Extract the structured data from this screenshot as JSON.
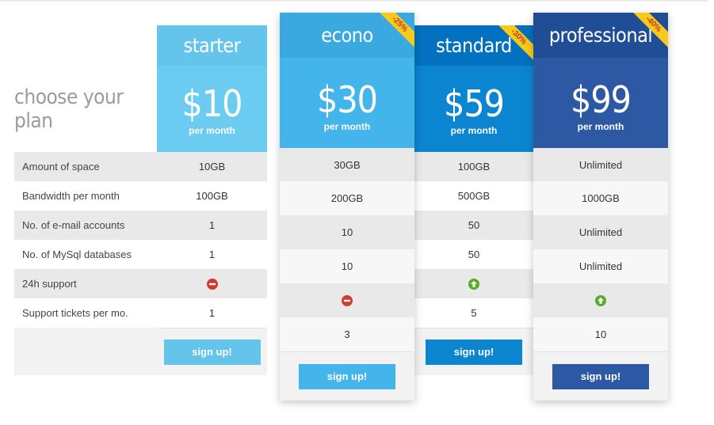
{
  "heading": "choose your plan",
  "features": [
    "Amount of space",
    "Bandwidth per month",
    "No. of e-mail accounts",
    "No. of MySql databases",
    "24h support",
    "Support tickets per mo."
  ],
  "colors": {
    "starter": "#64c4ec",
    "starter_price": "#6ccbf0",
    "econo": "#3aa9e0",
    "econo_price": "#43b5ea",
    "standard": "#0271bf",
    "standard_price": "#0c85d0",
    "professional": "#1f4e96",
    "professional_price": "#2d58a3",
    "no_icon": "#d23b34",
    "yes_icon": "#59a92b",
    "ribbon": "#f7c91a"
  },
  "plans": [
    {
      "id": "starter",
      "name": "starter",
      "price": "$10",
      "period": "per month",
      "badge": "",
      "values": [
        "10GB",
        "100GB",
        "1",
        "1",
        "no-icon",
        "1"
      ],
      "button": "sign up!"
    },
    {
      "id": "econo",
      "name": "econo",
      "price": "$30",
      "period": "per month",
      "badge": "-25%",
      "values": [
        "30GB",
        "200GB",
        "10",
        "10",
        "no-icon",
        "3"
      ],
      "button": "sign up!"
    },
    {
      "id": "standard",
      "name": "standard",
      "price": "$59",
      "period": "per month",
      "badge": "-30%",
      "values": [
        "100GB",
        "500GB",
        "50",
        "50",
        "yes-icon",
        "5"
      ],
      "button": "sign up!"
    },
    {
      "id": "professional",
      "name": "professional",
      "price": "$99",
      "period": "per month",
      "badge": "-40%",
      "values": [
        "Unlimited",
        "1000GB",
        "Unlimited",
        "Unlimited",
        "yes-icon",
        "10"
      ],
      "button": "sign up!"
    }
  ]
}
